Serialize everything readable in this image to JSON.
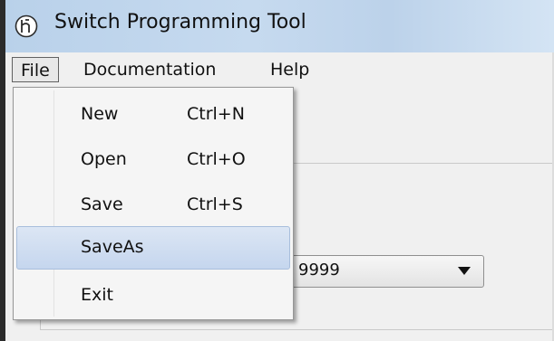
{
  "window": {
    "title": "Switch Programming Tool",
    "icon": "app-logo-icon"
  },
  "menubar": {
    "items": [
      {
        "label": "File",
        "active": true
      },
      {
        "label": "Documentation",
        "active": false
      },
      {
        "label": "Help",
        "active": false
      }
    ]
  },
  "file_menu": {
    "items": [
      {
        "label": "New",
        "shortcut": "Ctrl+N",
        "highlighted": false
      },
      {
        "label": "Open",
        "shortcut": "Ctrl+O",
        "highlighted": false
      },
      {
        "label": "Save",
        "shortcut": "Ctrl+S",
        "highlighted": false
      },
      {
        "label": "SaveAs",
        "shortcut": "",
        "highlighted": true
      },
      {
        "label": "Exit",
        "shortcut": "",
        "highlighted": false
      }
    ]
  },
  "combo": {
    "value": "9999"
  },
  "colors": {
    "highlight": "#c5d6ee",
    "titlebar": "#c6daef"
  }
}
